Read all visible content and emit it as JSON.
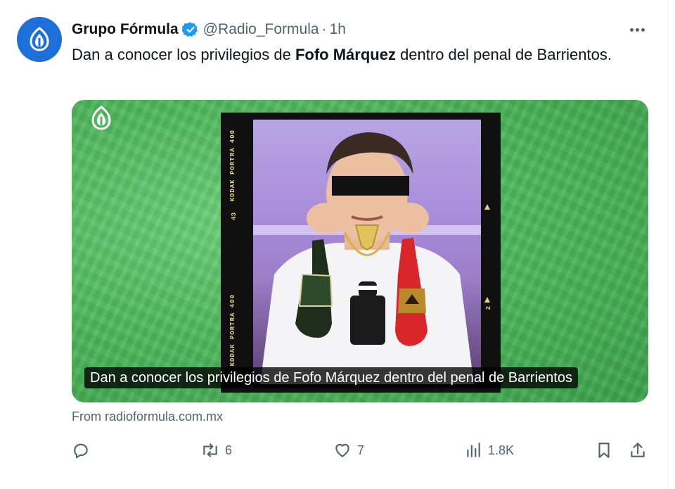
{
  "tweet": {
    "display_name": "Grupo Fórmula",
    "handle": "@Radio_Formula",
    "separator": "·",
    "time": "1h",
    "text_before": "Dan a conocer los privilegios de ",
    "text_bold": "Fofo Márquez",
    "text_after": " dentro del penal de Barrientos."
  },
  "card": {
    "caption": "Dan a conocer los privilegios de Fofo Márquez dentro del penal de Barrientos",
    "film_label_top": "KODAK PORTRA 400",
    "film_number": "43",
    "film_label_bottom": "KODAK PORTRA 400",
    "film_number_right": "2",
    "source": "From radioformula.com.mx"
  },
  "actions": {
    "replies": "",
    "reposts": "6",
    "likes": "7",
    "views": "1.8K"
  },
  "icons": {
    "avatar": "grupo-formula-logo",
    "verified": "verified-badge-icon",
    "more": "more-icon",
    "reply": "reply-icon",
    "repost": "repost-icon",
    "like": "heart-icon",
    "views": "views-icon",
    "bookmark": "bookmark-icon",
    "share": "share-icon"
  },
  "colors": {
    "brand": "#1d6fd9",
    "verified": "#1d9bf0",
    "muted": "#536471",
    "card_green": "#4fb85d"
  }
}
